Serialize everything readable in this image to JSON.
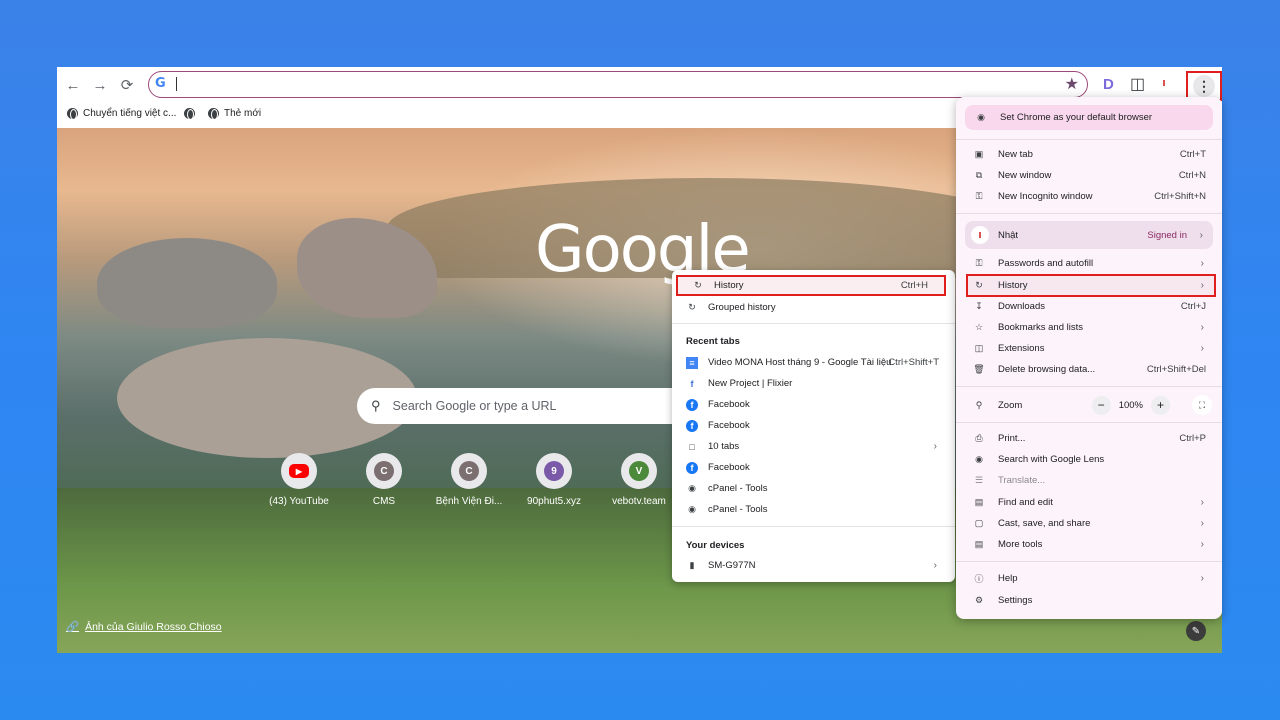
{
  "toolbar": {
    "back_icon": "arrow-left-icon",
    "forward_icon": "arrow-right-icon",
    "reload_icon": "reload-icon",
    "omnibox_value": "",
    "bookmark_icon": "star-icon",
    "ext_label": "D",
    "menu_icon": "three-dots-icon"
  },
  "bookmarks": [
    {
      "label": "Chuyển tiếng việt c..."
    },
    {
      "label": ""
    },
    {
      "label": "Thẻ mới"
    }
  ],
  "ntp": {
    "logo_text": "Google",
    "search_placeholder": "Search Google or type a URL",
    "shortcuts": [
      {
        "label": "(43) YouTube",
        "letter": "▶",
        "color": "#ff0000"
      },
      {
        "label": "CMS",
        "letter": "C",
        "color": "#7b6f6f"
      },
      {
        "label": "Bệnh Viện Đi...",
        "letter": "C",
        "color": "#7b6f6f"
      },
      {
        "label": "90phut5.xyz",
        "letter": "9",
        "color": "#7a5aa8"
      },
      {
        "label": "vebotv.team",
        "letter": "V",
        "color": "#4a8a3a"
      }
    ],
    "photo_credit": "Ảnh của Giulio Rosso Chioso"
  },
  "history_submenu": {
    "history": {
      "label": "History",
      "shortcut": "Ctrl+H"
    },
    "grouped": {
      "label": "Grouped history"
    },
    "recent_heading": "Recent tabs",
    "recent_tabs": [
      {
        "label": "Video MONA Host tháng 9 - Google Tài liệu",
        "shortcut": "Ctrl+Shift+T",
        "icon": "docs-icon"
      },
      {
        "label": "New Project | Flixier",
        "icon": "flixier-icon"
      },
      {
        "label": "Facebook",
        "icon": "facebook-icon"
      },
      {
        "label": "Facebook",
        "icon": "facebook-icon"
      },
      {
        "label": "10 tabs",
        "icon": "tabs-icon"
      },
      {
        "label": "Facebook",
        "icon": "facebook-icon"
      },
      {
        "label": "cPanel - Tools",
        "icon": "cpanel-icon"
      },
      {
        "label": "cPanel - Tools",
        "icon": "cpanel-icon"
      }
    ],
    "devices_heading": "Your devices",
    "device": {
      "label": "SM-G977N"
    }
  },
  "main_menu": {
    "default_banner": "Set Chrome as your default browser",
    "new_tab": {
      "label": "New tab",
      "shortcut": "Ctrl+T"
    },
    "new_window": {
      "label": "New window",
      "shortcut": "Ctrl+N"
    },
    "incognito": {
      "label": "New Incognito window",
      "shortcut": "Ctrl+Shift+N"
    },
    "profile": {
      "name": "Nhật",
      "status": "Signed in"
    },
    "passwords": {
      "label": "Passwords and autofill"
    },
    "history": {
      "label": "History"
    },
    "downloads": {
      "label": "Downloads",
      "shortcut": "Ctrl+J"
    },
    "bookmarks": {
      "label": "Bookmarks and lists"
    },
    "extensions": {
      "label": "Extensions"
    },
    "delete_data": {
      "label": "Delete browsing data...",
      "shortcut": "Ctrl+Shift+Del"
    },
    "zoom": {
      "label": "Zoom",
      "minus": "−",
      "value": "100%",
      "plus": "+"
    },
    "print": {
      "label": "Print...",
      "shortcut": "Ctrl+P"
    },
    "lens": {
      "label": "Search with Google Lens"
    },
    "translate": {
      "label": "Translate..."
    },
    "find_edit": {
      "label": "Find and edit"
    },
    "cast": {
      "label": "Cast, save, and share"
    },
    "more_tools": {
      "label": "More tools"
    },
    "help": {
      "label": "Help"
    },
    "settings": {
      "label": "Settings"
    }
  }
}
